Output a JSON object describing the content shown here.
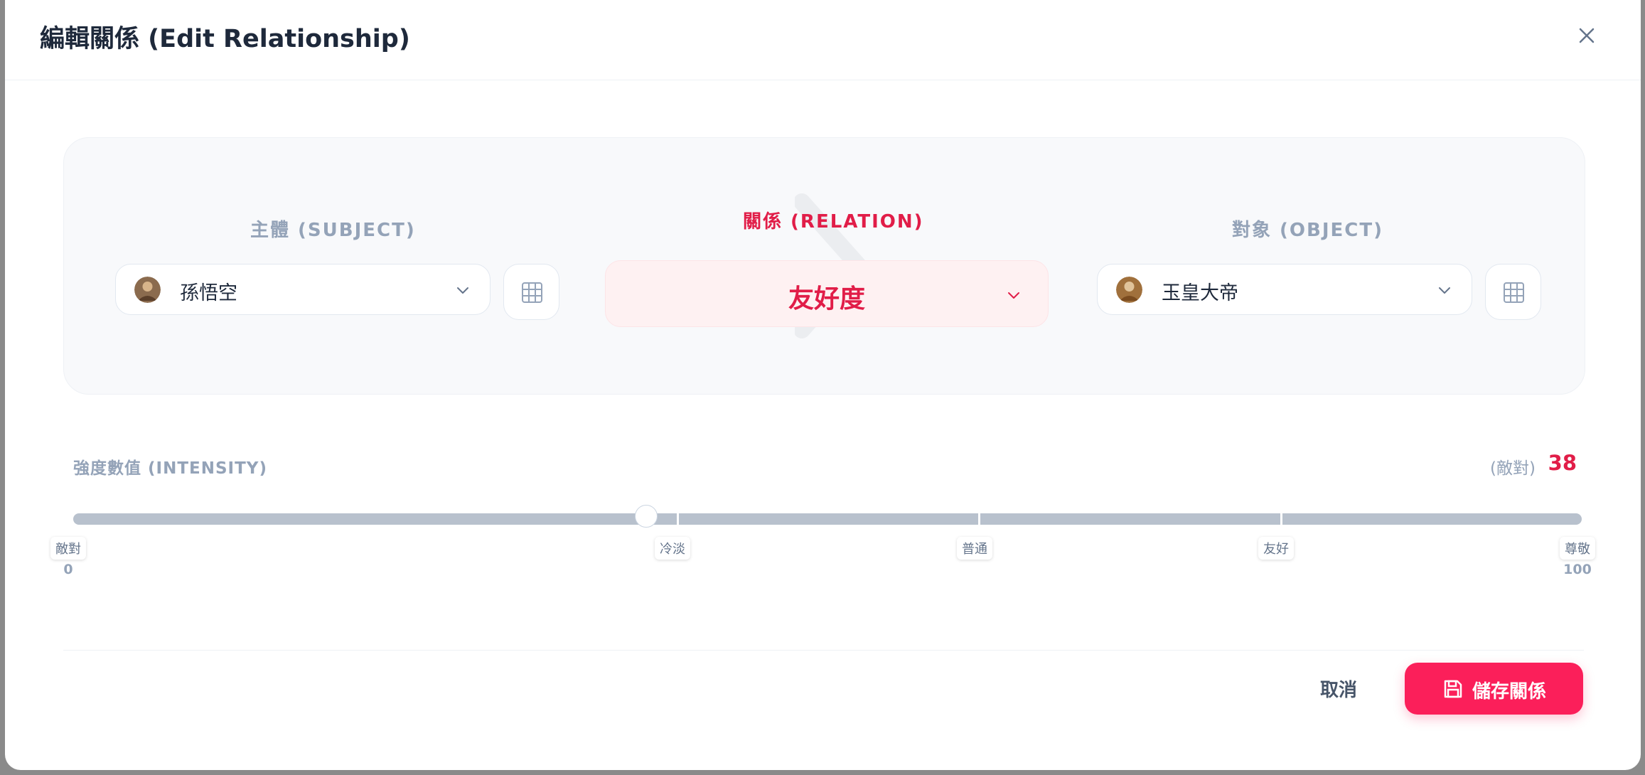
{
  "dialog": {
    "title": "編輯關係 (Edit Relationship)"
  },
  "subject": {
    "label": "主體 (SUBJECT)",
    "value": "孫悟空"
  },
  "relation": {
    "label": "關係 (RELATION)",
    "value": "友好度"
  },
  "object": {
    "label": "對象 (OBJECT)",
    "value": "玉皇大帝"
  },
  "intensity": {
    "label": "強度數值 (INTENSITY)",
    "state": "(敵對)",
    "value": "38",
    "min": "0",
    "max": "100",
    "ticks": [
      "敵對",
      "冷淡",
      "普通",
      "友好",
      "尊敬"
    ]
  },
  "footer": {
    "cancel_label": "取消",
    "save_label": "儲存關係"
  },
  "colors": {
    "accent": "#e11d48",
    "save_button": "#fb1f5a",
    "muted": "#94a3b8"
  }
}
